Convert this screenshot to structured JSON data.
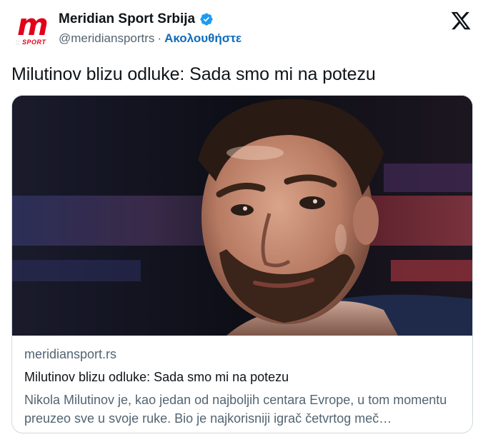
{
  "account": {
    "display_name": "Meridian Sport Srbija",
    "handle": "@meridiansportrs",
    "separator": "·",
    "follow_label": "Ακολουθήστε",
    "avatar_letter": "m",
    "avatar_caption_dots": "::",
    "avatar_caption": "SPORT",
    "verified": true
  },
  "tweet": {
    "text": "Milutinov blizu odluke: Sada smo mi na potezu"
  },
  "card": {
    "image_icon": "basketball-player-portrait",
    "domain": "meridiansport.rs",
    "title": "Milutinov blizu odluke: Sada smo mi na potezu",
    "description": "Nikola Milutinov je, kao jedan od najboljih centara Evrope, u tom momentu preuzeo sve u svoje ruke. Bio je najkorisniji igrač četvrtog meč…"
  },
  "colors": {
    "brand_red": "#e2001a",
    "link_blue": "#0f6cbd",
    "verified_blue": "#1d9bf0",
    "muted_text": "#536471"
  }
}
